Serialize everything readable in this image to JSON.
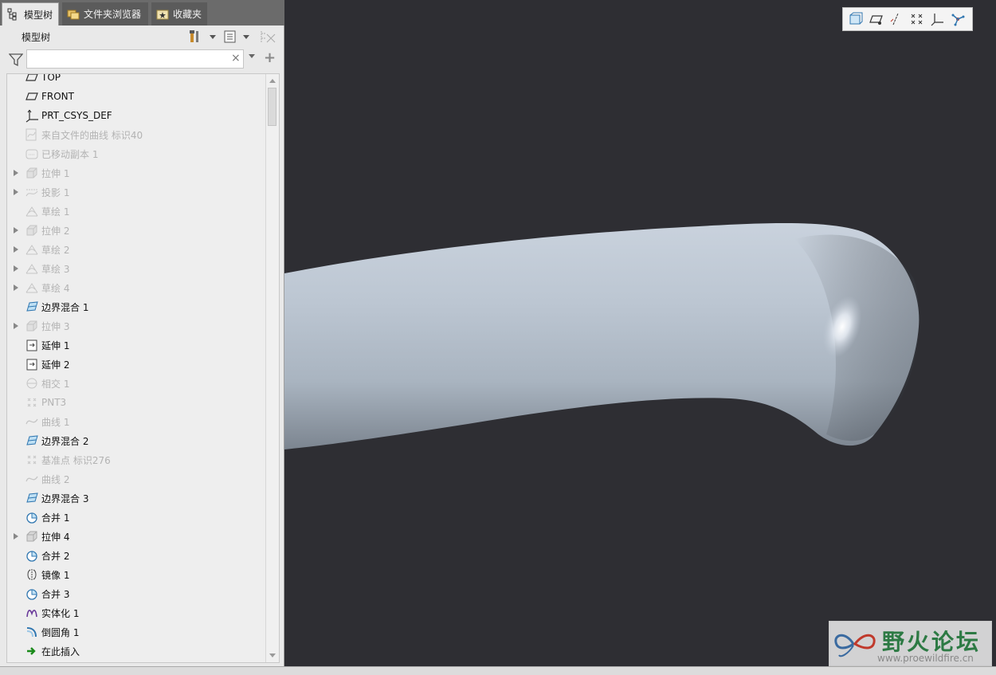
{
  "tabs": [
    {
      "label": "模型树",
      "active": true
    },
    {
      "label": "文件夹浏览器",
      "active": false
    },
    {
      "label": "收藏夹",
      "active": false
    }
  ],
  "tree_title": "模型树",
  "search": {
    "value": "",
    "placeholder": "",
    "clear": "×",
    "add": "+"
  },
  "tree_items": [
    {
      "label": "TOP",
      "icon": "datum-plane-icon",
      "dim": false,
      "expandable": false
    },
    {
      "label": "FRONT",
      "icon": "datum-plane-icon",
      "dim": false,
      "expandable": false
    },
    {
      "label": "PRT_CSYS_DEF",
      "icon": "csys-icon",
      "dim": false,
      "expandable": false
    },
    {
      "label": "来自文件的曲线 标识40",
      "icon": "curve-file-icon",
      "dim": true,
      "expandable": false
    },
    {
      "label": "已移动副本 1",
      "icon": "moved-copy-icon",
      "dim": true,
      "expandable": false
    },
    {
      "label": "拉伸 1",
      "icon": "extrude-icon",
      "dim": true,
      "expandable": true
    },
    {
      "label": "投影 1",
      "icon": "project-icon",
      "dim": true,
      "expandable": true
    },
    {
      "label": "草绘 1",
      "icon": "sketch-icon",
      "dim": true,
      "expandable": false
    },
    {
      "label": "拉伸 2",
      "icon": "extrude-icon",
      "dim": true,
      "expandable": true
    },
    {
      "label": "草绘 2",
      "icon": "sketch-icon",
      "dim": true,
      "expandable": true
    },
    {
      "label": "草绘 3",
      "icon": "sketch-icon",
      "dim": true,
      "expandable": true
    },
    {
      "label": "草绘 4",
      "icon": "sketch-icon",
      "dim": true,
      "expandable": true
    },
    {
      "label": "边界混合 1",
      "icon": "boundary-blend-icon",
      "dim": false,
      "expandable": false
    },
    {
      "label": "拉伸 3",
      "icon": "extrude-icon",
      "dim": true,
      "expandable": true
    },
    {
      "label": "延伸 1",
      "icon": "extend-icon",
      "dim": false,
      "expandable": false
    },
    {
      "label": "延伸 2",
      "icon": "extend-icon",
      "dim": false,
      "expandable": false
    },
    {
      "label": "相交 1",
      "icon": "intersect-icon",
      "dim": true,
      "expandable": false
    },
    {
      "label": "PNT3",
      "icon": "datum-point-icon",
      "dim": true,
      "expandable": false
    },
    {
      "label": "曲线 1",
      "icon": "curve-icon",
      "dim": true,
      "expandable": false
    },
    {
      "label": "边界混合 2",
      "icon": "boundary-blend-icon",
      "dim": false,
      "expandable": false
    },
    {
      "label": "基准点 标识276",
      "icon": "datum-point-icon",
      "dim": true,
      "expandable": false
    },
    {
      "label": "曲线 2",
      "icon": "curve-icon",
      "dim": true,
      "expandable": false
    },
    {
      "label": "边界混合 3",
      "icon": "boundary-blend-icon",
      "dim": false,
      "expandable": false
    },
    {
      "label": "合并 1",
      "icon": "merge-icon",
      "dim": false,
      "expandable": false
    },
    {
      "label": "拉伸 4",
      "icon": "extrude-icon",
      "dim": false,
      "expandable": true
    },
    {
      "label": "合并 2",
      "icon": "merge-icon",
      "dim": false,
      "expandable": false
    },
    {
      "label": "镜像 1",
      "icon": "mirror-icon",
      "dim": false,
      "expandable": false
    },
    {
      "label": "合并 3",
      "icon": "merge-icon",
      "dim": false,
      "expandable": false
    },
    {
      "label": "实体化 1",
      "icon": "solidify-icon",
      "dim": false,
      "expandable": false
    },
    {
      "label": "倒圆角 1",
      "icon": "round-icon",
      "dim": false,
      "expandable": false
    },
    {
      "label": "在此插入",
      "icon": "insert-here-icon",
      "dim": false,
      "expandable": false
    }
  ],
  "view_toolbar_icons": [
    "plane-display-icon",
    "datum-plane-display-icon",
    "axis-display-icon",
    "point-display-icon",
    "csys-display-icon",
    "spin-center-icon"
  ],
  "watermark": {
    "title": "野火论坛",
    "url": "www.proewildfire.cn"
  },
  "colors": {
    "viewport_bg": "#2e2e33",
    "model": "#b7c3d0",
    "accent": "#2d7a44"
  }
}
